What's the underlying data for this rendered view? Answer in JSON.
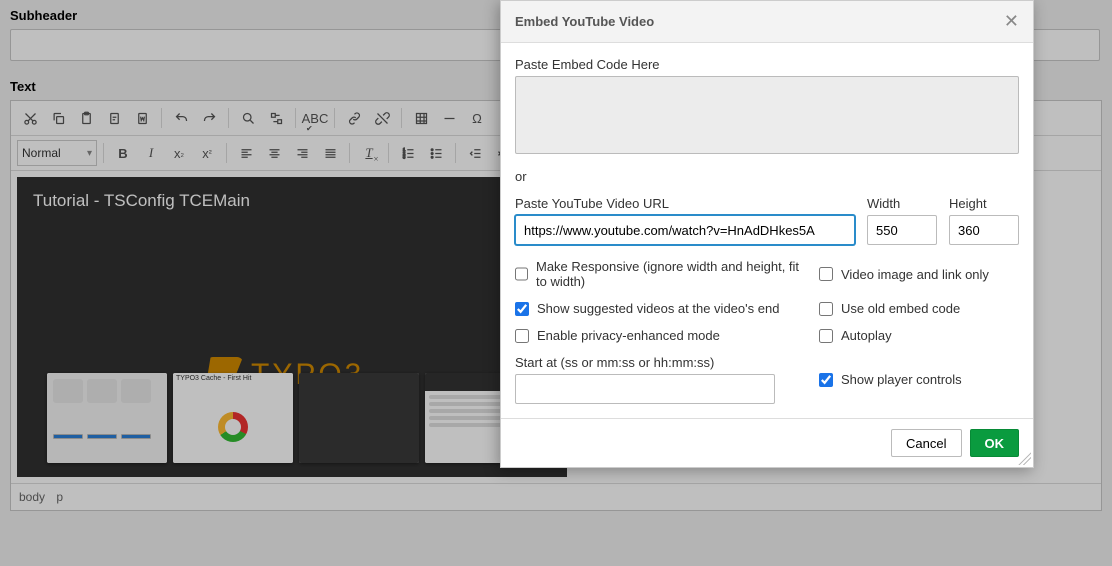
{
  "labels": {
    "subheader": "Subheader",
    "text": "Text",
    "format_normal": "Normal"
  },
  "video": {
    "title": "Tutorial - TSConfig TCEMain",
    "thumb2_title": "TYPO3 Cache - First Hit",
    "typo3_word": "TYPO3"
  },
  "status": {
    "p1": "body",
    "p2": "p"
  },
  "dialog": {
    "title": "Embed YouTube Video",
    "paste_embed_label": "Paste Embed Code Here",
    "or": "or",
    "url_label": "Paste YouTube Video URL",
    "url_value": "https://www.youtube.com/watch?v=HnAdDHkes5A",
    "width_label": "Width",
    "width_value": "550",
    "height_label": "Height",
    "height_value": "360",
    "opt_responsive": "Make Responsive (ignore width and height, fit to width)",
    "opt_imagelink": "Video image and link only",
    "opt_suggested": "Show suggested videos at the video's end",
    "opt_oldembed": "Use old embed code",
    "opt_privacy": "Enable privacy-enhanced mode",
    "opt_autoplay": "Autoplay",
    "start_label": "Start at (ss or mm:ss or hh:mm:ss)",
    "opt_controls": "Show player controls",
    "cancel": "Cancel",
    "ok": "OK"
  }
}
